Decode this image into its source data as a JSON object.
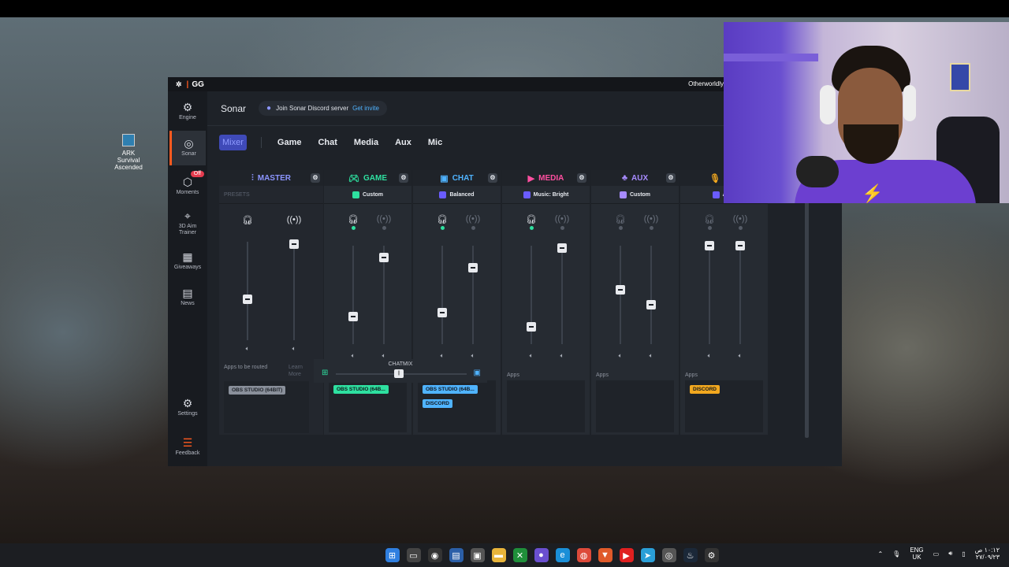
{
  "window": {
    "brand": "GG",
    "user": "Otherworldly"
  },
  "desktop": {
    "icon_label": "ARK Survival Ascended"
  },
  "sidebar": {
    "items": [
      {
        "label": "Engine",
        "icon": "engine-icon"
      },
      {
        "label": "Sonar",
        "icon": "sonar-icon"
      },
      {
        "label": "Moments",
        "icon": "moments-icon",
        "badge": "Off"
      },
      {
        "label": "3D Aim Trainer",
        "icon": "aim-icon"
      },
      {
        "label": "Giveaways",
        "icon": "gift-icon"
      },
      {
        "label": "News",
        "icon": "news-icon"
      },
      {
        "label": "Settings",
        "icon": "gear-icon"
      },
      {
        "label": "Feedback",
        "icon": "feedback-icon"
      }
    ]
  },
  "header": {
    "title": "Sonar",
    "discord_text": "Join Sonar Discord server",
    "discord_link": "Get invite"
  },
  "tabs": [
    "Mixer",
    "Game",
    "Chat",
    "Media",
    "Aux",
    "Mic"
  ],
  "mixer": {
    "presets_placeholder": "PRESETS",
    "master": {
      "name": "MASTER",
      "color": "#8c95ff",
      "apps_label": "Apps to be routed",
      "learn_more": "Learn More",
      "apps": [
        "OBS STUDIO (64BIT)"
      ],
      "levels": [
        0.42,
        0.98
      ]
    },
    "channels": [
      {
        "name": "GAME",
        "color": "#2ee0a0",
        "preset": "Custom",
        "preset_color": "#2ee0a0",
        "apps_label": "Apps",
        "apps": [
          "OBS STUDIO (64B..."
        ],
        "app_color": "#2ee0a0",
        "levels": [
          0.28,
          0.88
        ],
        "monitor_on": true
      },
      {
        "name": "CHAT",
        "color": "#4fb3ff",
        "preset": "Balanced",
        "preset_color": "#6a5cff",
        "apps_label": "Apps",
        "apps": [
          "OBS STUDIO (64B...",
          "DISCORD"
        ],
        "app_color": "#4fb3ff",
        "levels": [
          0.32,
          0.78
        ],
        "monitor_on": true
      },
      {
        "name": "MEDIA",
        "color": "#ff4fa0",
        "preset": "Music: Bright",
        "preset_color": "#6a5cff",
        "apps_label": "Apps",
        "apps": [],
        "app_color": "#ff4fa0",
        "levels": [
          0.18,
          0.98
        ],
        "monitor_on": true
      },
      {
        "name": "AUX",
        "color": "#a78bff",
        "preset": "Custom",
        "preset_color": "#a78bff",
        "apps_label": "Apps",
        "apps": [],
        "app_color": "#a78bff",
        "levels": [
          0.55,
          0.4
        ],
        "monitor_on": false
      },
      {
        "name": "MIC",
        "color": "#f2a81f",
        "preset": "Alias",
        "preset_color": "#6a5cff",
        "apps_label": "Apps",
        "apps": [
          "DISCORD"
        ],
        "app_color": "#f2a81f",
        "levels": [
          1.0,
          1.0
        ],
        "monitor_on": false
      }
    ],
    "chatmix_label": "CHATMIX"
  },
  "taskbar": {
    "lang": "ENG",
    "region": "UK",
    "time": "١٠:١٢ ص",
    "date": "٢٧/٠٩/٢٣"
  }
}
